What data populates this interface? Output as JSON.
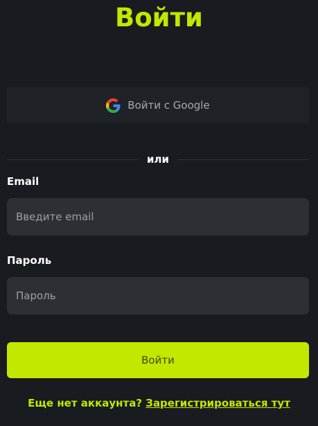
{
  "page": {
    "title": "Войти"
  },
  "google": {
    "label": "Войти с Google",
    "icon": "google-g-icon"
  },
  "divider": {
    "text": "или"
  },
  "email": {
    "label": "Email",
    "placeholder": "Введите email",
    "value": ""
  },
  "password": {
    "label": "Пароль",
    "placeholder": "Пароль",
    "value": ""
  },
  "submit": {
    "label": "Войти"
  },
  "footer": {
    "prompt": "Еще нет аккаунта?",
    "link_label": "Зарегистрироваться тут"
  },
  "colors": {
    "background": "#181b1f",
    "accent": "#c2e800",
    "input_background": "#2c3035",
    "google_button_background": "#1f2226"
  }
}
